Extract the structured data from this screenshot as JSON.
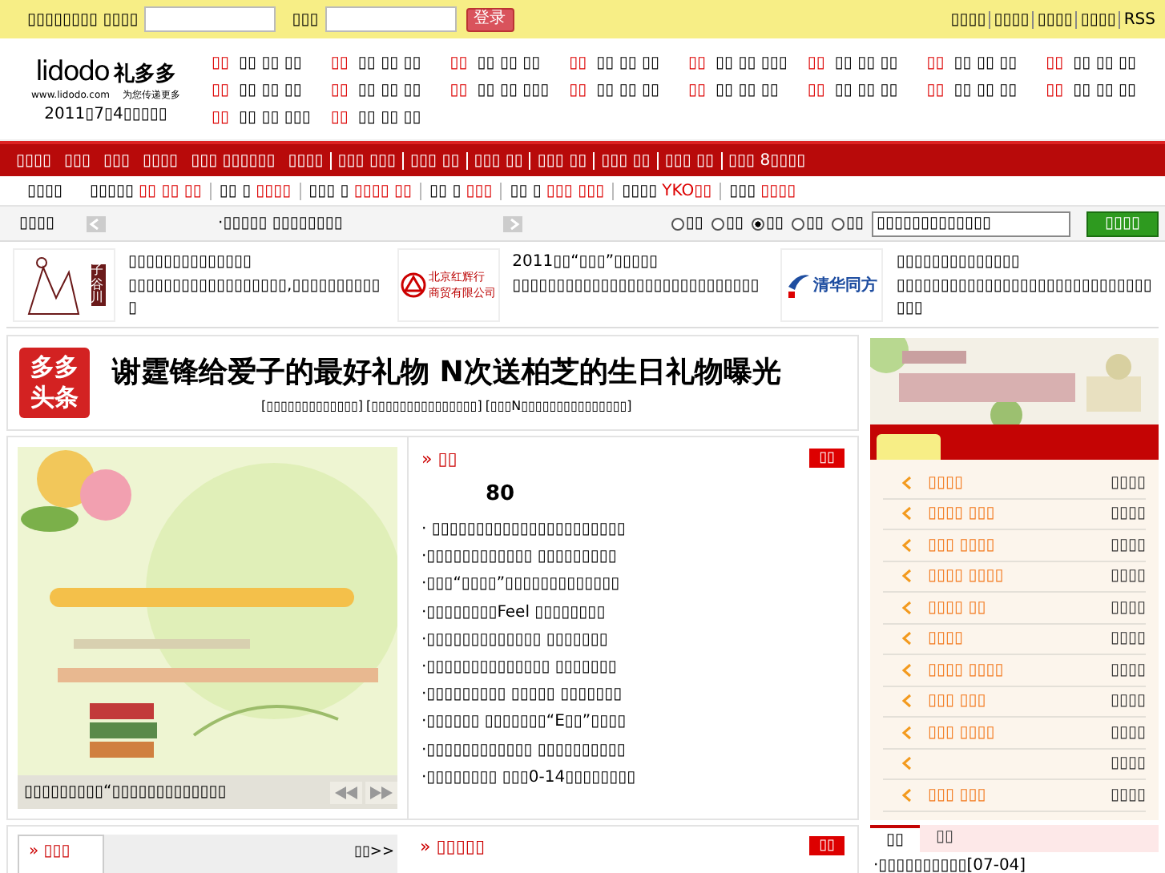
{
  "top_bar": {
    "user_label": "▯▯▯▯▯▯▯▯ ▯▯▯▯",
    "password_label": "▯▯▯",
    "login_button": "登录",
    "links": [
      "▯▯▯▯",
      "▯▯▯▯",
      "▯▯▯▯",
      "▯▯▯▯",
      "RSS"
    ]
  },
  "logo": {
    "wordmark": "lidodo",
    "brand": "礼多多",
    "url": "www.lidodo.com",
    "slogan": "为您传递更多",
    "date": "2011▯7▯4▯▯▯▯▯"
  },
  "channel_nav": [
    {
      "tag": "▯▯",
      "links": "▯▯ ▯▯ ▯▯"
    },
    {
      "tag": "▯▯",
      "links": "▯▯ ▯▯ ▯▯"
    },
    {
      "tag": "▯▯",
      "links": "▯▯ ▯▯ ▯▯"
    },
    {
      "tag": "▯▯",
      "links": "▯▯ ▯▯ ▯▯"
    },
    {
      "tag": "▯▯",
      "links": "▯▯ ▯▯ ▯▯▯"
    },
    {
      "tag": "▯▯",
      "links": "▯▯ ▯▯ ▯▯"
    },
    {
      "tag": "▯▯",
      "links": "▯▯ ▯▯ ▯▯"
    },
    {
      "tag": "▯▯",
      "links": "▯▯ ▯▯ ▯▯"
    },
    {
      "tag": "▯▯",
      "links": "▯▯ ▯▯ ▯▯"
    },
    {
      "tag": "▯▯",
      "links": "▯▯ ▯▯ ▯▯"
    },
    {
      "tag": "▯▯",
      "links": "▯▯ ▯▯ ▯▯▯"
    },
    {
      "tag": "▯▯",
      "links": "▯▯ ▯▯ ▯▯"
    },
    {
      "tag": "▯▯",
      "links": "▯▯ ▯▯ ▯▯"
    },
    {
      "tag": "▯▯",
      "links": "▯▯ ▯▯ ▯▯"
    },
    {
      "tag": "▯▯",
      "links": "▯▯ ▯▯ ▯▯"
    },
    {
      "tag": "▯▯",
      "links": "▯▯ ▯▯ ▯▯"
    },
    {
      "tag": "▯▯",
      "links": "▯▯ ▯▯ ▯▯▯"
    },
    {
      "tag": "▯▯",
      "links": "▯▯ ▯▯ ▯▯"
    }
  ],
  "main_menu": [
    "▯▯▯▯",
    "▯▯▯",
    "▯▯▯",
    "▯▯▯▯",
    "▯▯▯ ▯▯▯▯▯▯",
    "▯▯▯▯",
    "▯▯▯ ▯▯▯",
    "▯▯▯ ▯▯",
    "▯▯▯ ▯▯",
    "▯▯▯ ▯▯",
    "▯▯▯ ▯▯",
    "▯▯▯ ▯▯",
    "▯▯▯ 8▯▯▯▯"
  ],
  "sub_menu": [
    {
      "label": "▯▯▯▯"
    },
    {
      "label": "▯▯▯▯▯",
      "links": "▯▯ ▯▯ ▯▯"
    },
    {
      "label": "▯▯ ▯",
      "links": "▯▯▯▯"
    },
    {
      "label": "▯▯▯ ▯",
      "links": "▯▯▯▯ ▯▯"
    },
    {
      "label": "▯▯ ▯",
      "links": "▯▯▯"
    },
    {
      "label": "▯▯ ▯",
      "links": "▯▯▯ ▯▯▯"
    },
    {
      "label": "▯▯▯▯",
      "links": "YKO▯▯"
    },
    {
      "label": "▯▯▯",
      "links": "▯▯▯▯"
    }
  ],
  "ticker": {
    "label": "▯▯▯▯",
    "text": "·▯▯▯▯▯ ▯▯▯▯▯▯▯▯"
  },
  "search": {
    "scopes": [
      {
        "label": "▯▯",
        "selected": false
      },
      {
        "label": "▯▯",
        "selected": false
      },
      {
        "label": "▯▯",
        "selected": true
      },
      {
        "label": "▯▯",
        "selected": false
      },
      {
        "label": "▯▯",
        "selected": false
      }
    ],
    "value": "▯▯▯▯▯▯▯▯▯▯▯▯▯",
    "button": "▯▯▯▯"
  },
  "partners": [
    {
      "logo": [
        "子谷川"
      ],
      "kind": "seal",
      "title": "▯▯▯▯▯▯▯▯▯▯▯▯▯▯",
      "desc": "▯▯▯▯▯▯▯▯▯▯▯▯▯▯▯▯▯▯,▯▯▯▯▯▯▯▯▯▯▯"
    },
    {
      "logo": [
        "北京红辉行",
        "商贸有限公司"
      ],
      "kind": "emblem",
      "title": "2011▯▯“▯▯▯”▯▯▯▯▯",
      "desc": "▯▯▯▯▯▯▯▯▯▯▯▯▯▯▯▯▯▯▯▯▯▯▯▯▯▯▯▯"
    },
    {
      "logo": [
        "清华同方"
      ],
      "kind": "mark",
      "title": "▯▯▯▯▯▯▯▯▯▯▯▯▯▯",
      "desc": "▯▯▯▯▯▯▯▯▯▯▯▯▯▯▯▯▯▯▯▯▯▯▯▯▯▯▯▯▯▯▯▯"
    }
  ],
  "headline": {
    "badge": "多多头条",
    "title": "谢霆锋给爱子的最好礼物  N次送柏芝的生日礼物曝光",
    "links": [
      "[▯▯▯▯▯▯▯▯▯▯▯▯▯]",
      "[▯▯▯▯▯▯▯▯▯▯▯▯▯▯▯]",
      "[▯▯▯N▯▯▯▯▯▯▯▯▯▯▯▯▯▯▯]"
    ]
  },
  "slideshow": {
    "caption": "▯▯▯▯▯▯▯▯▯“▯▯▯▯▯▯▯▯▯▯▯▯▯"
  },
  "news": {
    "title": "» ▯▯",
    "more": "▯▯",
    "featured": "80",
    "items": [
      "· ▯▯▯▯▯▯▯▯▯▯▯▯▯▯▯▯▯▯▯▯▯▯",
      "·▯▯▯▯▯▯▯▯▯▯▯▯ ▯▯▯▯▯▯▯▯▯",
      "·▯▯▯“▯▯▯▯”▯▯▯▯▯▯▯▯▯▯▯▯▯",
      "·▯▯▯▯▯▯▯▯Feel ▯▯▯▯▯▯▯▯",
      "·▯▯▯▯▯▯▯▯▯▯▯▯▯ ▯▯▯▯▯▯▯",
      "·▯▯▯▯▯▯▯▯▯▯▯▯▯▯ ▯▯▯▯▯▯▯",
      "·▯▯▯▯▯▯▯▯▯ ▯▯▯▯▯ ▯▯▯▯▯▯▯",
      "·▯▯▯▯▯▯ ▯▯▯▯▯▯▯“E▯▯”▯▯▯▯",
      "·▯▯▯▯▯▯▯▯▯▯▯▯ ▯▯▯▯▯▯▯▯▯▯",
      "·▯▯▯▯▯▯▯▯ ▯▯▯0-14▯▯▯▯▯▯▯▯"
    ]
  },
  "bottom_left": {
    "tab": "» ▯▯▯",
    "more": "▯▯>>"
  },
  "bottom_right": {
    "title": "» ▯▯▯▯▯",
    "more": "▯▯"
  },
  "events": {
    "items": [
      {
        "title": "▯▯▯▯",
        "date": "▯▯▯▯"
      },
      {
        "title": "▯▯▯▯ ▯▯▯",
        "date": "▯▯▯▯"
      },
      {
        "title": "▯▯▯ ▯▯▯▯",
        "date": "▯▯▯▯"
      },
      {
        "title": "▯▯▯▯ ▯▯▯▯",
        "date": "▯▯▯▯"
      },
      {
        "title": "▯▯▯▯ ▯▯",
        "date": "▯▯▯▯"
      },
      {
        "title": "▯▯▯▯",
        "date": "▯▯▯▯"
      },
      {
        "title": "▯▯▯▯ ▯▯▯▯",
        "date": "▯▯▯▯"
      },
      {
        "title": "▯▯▯ ▯▯▯",
        "date": "▯▯▯▯"
      },
      {
        "title": "▯▯▯ ▯▯▯▯",
        "date": "▯▯▯▯"
      },
      {
        "date": "▯▯▯▯"
      },
      {
        "title": "▯▯▯ ▯▯▯",
        "date": "▯▯▯▯"
      }
    ]
  },
  "side_tabs": {
    "tabs": [
      {
        "label": "▯▯",
        "selected": true
      },
      {
        "label": "▯▯",
        "selected": false
      }
    ],
    "first_item": "·▯▯▯▯▯▯▯▯▯▯[07-04]"
  }
}
